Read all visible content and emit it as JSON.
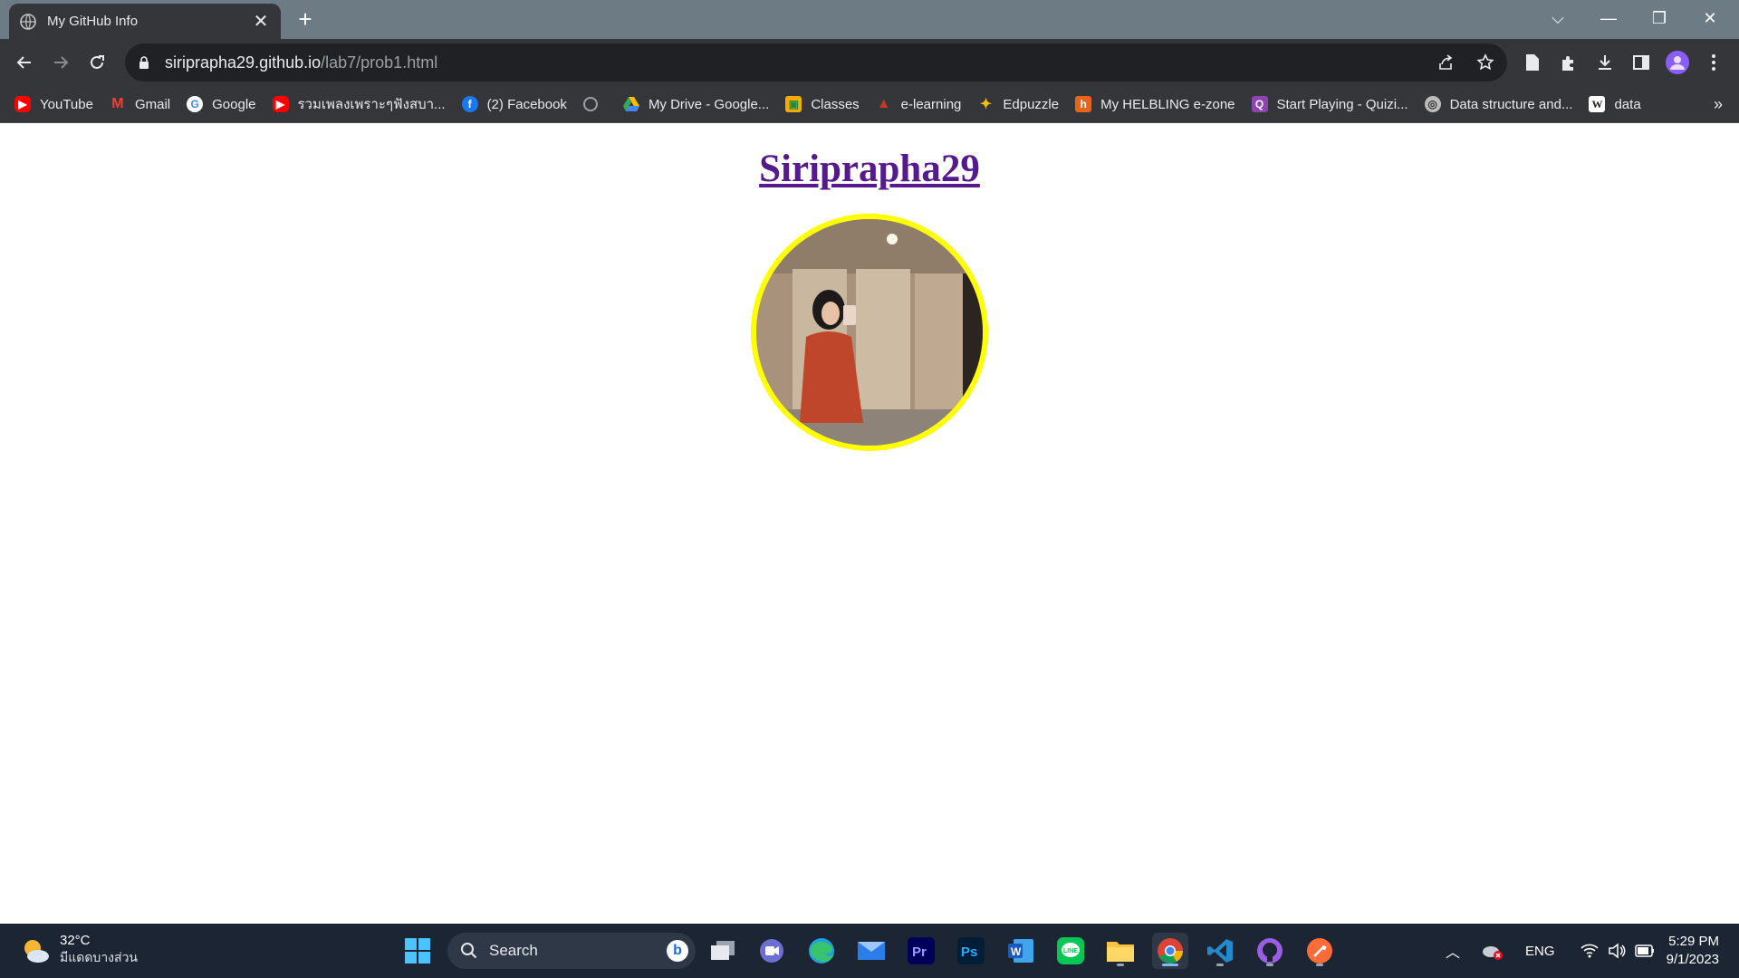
{
  "browser": {
    "tab": {
      "title": "My GitHub Info",
      "close": "✕"
    },
    "new_tab": "+",
    "window_controls": {
      "tab_search": "⌵",
      "minimize": "—",
      "restore": "❐",
      "close": "✕"
    },
    "url": {
      "host": "siripraphа29.github.io",
      "path": "/lab7/prob1.html"
    },
    "bookmarks": [
      {
        "label": "YouTube",
        "icon": "youtube-icon",
        "color": "#ff0000"
      },
      {
        "label": "Gmail",
        "icon": "gmail-icon",
        "color": "#ea4335"
      },
      {
        "label": "Google",
        "icon": "google-icon",
        "color": "#4285f4"
      },
      {
        "label": "รวมเพลงเพราะๆฟังสบา...",
        "icon": "youtube-icon",
        "color": "#ff0000"
      },
      {
        "label": "(2) Facebook",
        "icon": "facebook-icon",
        "color": "#1877f2"
      },
      {
        "label": "",
        "icon": "globe-icon",
        "color": "#9aa0a6"
      },
      {
        "label": "My Drive - Google...",
        "icon": "google-drive-icon",
        "color": "#fbbc04"
      },
      {
        "label": "Classes",
        "icon": "google-classroom-icon",
        "color": "#f9ab00"
      },
      {
        "label": "e-learning",
        "icon": "e-learning-icon",
        "color": "#c0392b"
      },
      {
        "label": "Edpuzzle",
        "icon": "edpuzzle-icon",
        "color": "#f4c20d"
      },
      {
        "label": "My HELBLING e-zone",
        "icon": "helbling-icon",
        "color": "#e8641b"
      },
      {
        "label": "Start Playing - Quizi...",
        "icon": "quizizz-icon",
        "color": "#8e44ad"
      },
      {
        "label": "Data structure and...",
        "icon": "data-structure-icon",
        "color": "#bdbdbd"
      },
      {
        "label": "data",
        "icon": "wikipedia-icon",
        "color": "#ffffff"
      }
    ],
    "bookmarks_more": "»"
  },
  "page": {
    "heading": "Siripraphа29",
    "avatar_alt": "profile photo"
  },
  "taskbar": {
    "weather": {
      "temp": "32°C",
      "desc": "มีแดดบางส่วน"
    },
    "search_placeholder": "Search",
    "tray": {
      "language": "ENG"
    },
    "clock": {
      "time": "5:29 PM",
      "date": "9/1/2023"
    }
  }
}
